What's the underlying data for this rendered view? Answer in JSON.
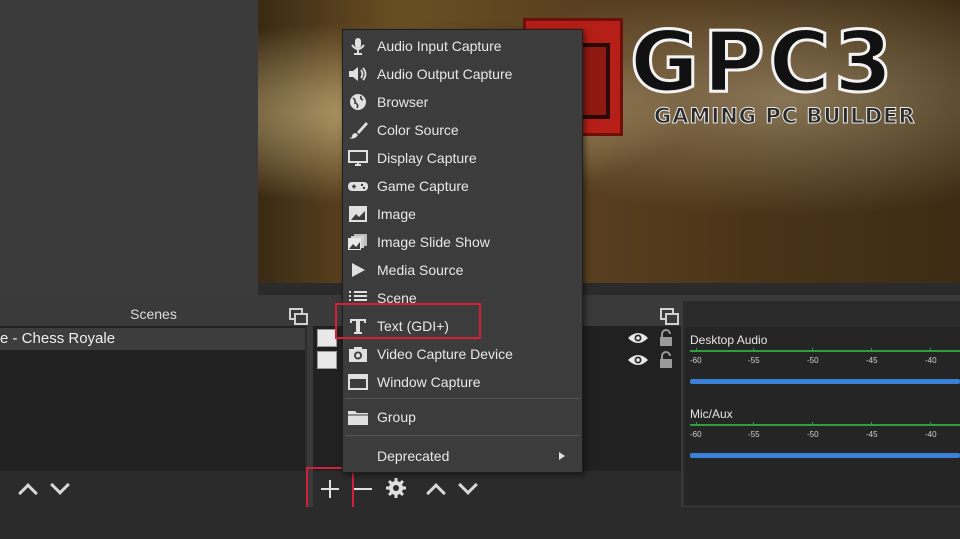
{
  "logo": {
    "main": "GPC3",
    "sub": "GAMING PC BUILDER"
  },
  "scenes": {
    "title": "Scenes",
    "items": [
      "e - Chess Royale"
    ]
  },
  "mixer": {
    "channels": [
      {
        "name": "Desktop Audio",
        "scale": [
          "-60",
          "-55",
          "-50",
          "-45",
          "-40"
        ]
      },
      {
        "name": "Mic/Aux",
        "scale": [
          "-60",
          "-55",
          "-50",
          "-45",
          "-40"
        ]
      }
    ]
  },
  "menu": {
    "items": [
      {
        "label": "Audio Input Capture",
        "icon": "microphone-icon"
      },
      {
        "label": "Audio Output Capture",
        "icon": "speaker-icon"
      },
      {
        "label": "Browser",
        "icon": "globe-icon"
      },
      {
        "label": "Color Source",
        "icon": "paintbrush-icon"
      },
      {
        "label": "Display Capture",
        "icon": "monitor-icon"
      },
      {
        "label": "Game Capture",
        "icon": "gamepad-icon"
      },
      {
        "label": "Image",
        "icon": "image-icon"
      },
      {
        "label": "Image Slide Show",
        "icon": "slideshow-icon"
      },
      {
        "label": "Media Source",
        "icon": "play-icon"
      },
      {
        "label": "Scene",
        "icon": "list-icon"
      },
      {
        "label": "Text (GDI+)",
        "icon": "text-icon"
      },
      {
        "label": "Video Capture Device",
        "icon": "camera-icon"
      },
      {
        "label": "Window Capture",
        "icon": "window-icon"
      }
    ],
    "group": "Group",
    "deprecated": "Deprecated"
  },
  "colors": {
    "highlight": "#d0203a",
    "meter_green": "#2f9e3e",
    "volume_blue": "#3a7fd8"
  }
}
